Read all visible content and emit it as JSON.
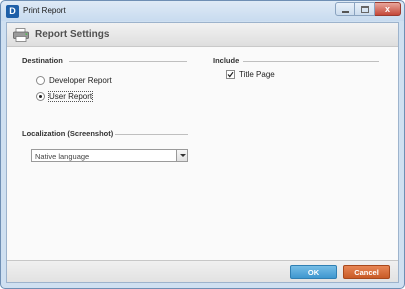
{
  "window": {
    "title": "Print Report",
    "app_icon_letter": "D",
    "controls": {
      "minimize": "",
      "maximize": "",
      "close": "x"
    }
  },
  "header": {
    "title": "Report Settings",
    "icon": "printer-icon"
  },
  "destination": {
    "label": "Destination",
    "options": [
      {
        "label": "Developer Report",
        "selected": false
      },
      {
        "label": "User Report",
        "selected": true
      }
    ]
  },
  "include": {
    "label": "Include",
    "items": [
      {
        "label": "Title Page",
        "checked": true
      }
    ]
  },
  "localization": {
    "label": "Localization (Screenshot)",
    "selected_value": "Native language"
  },
  "footer": {
    "ok_label": "OK",
    "cancel_label": "Cancel"
  }
}
